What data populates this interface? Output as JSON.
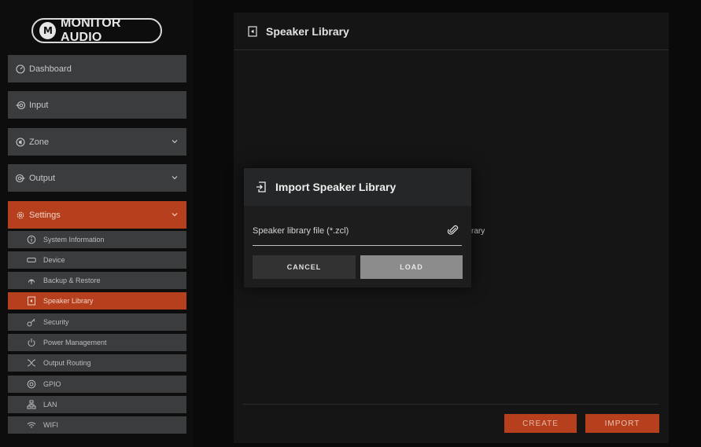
{
  "brand": {
    "logo_mark": "M",
    "logo_text": "MONITOR AUDIO"
  },
  "sidebar": {
    "items": [
      {
        "label": "Dashboard",
        "icon": "dashboard-icon",
        "expandable": false
      },
      {
        "label": "Input",
        "icon": "input-icon",
        "expandable": false
      },
      {
        "label": "Zone",
        "icon": "zone-icon",
        "expandable": true
      },
      {
        "label": "Output",
        "icon": "output-icon",
        "expandable": true
      },
      {
        "label": "Settings",
        "icon": "gear-icon",
        "expandable": true,
        "active": true
      }
    ],
    "settings_items": [
      {
        "label": "System Information",
        "icon": "info-icon"
      },
      {
        "label": "Device",
        "icon": "device-icon"
      },
      {
        "label": "Backup & Restore",
        "icon": "backup-icon"
      },
      {
        "label": "Speaker Library",
        "icon": "speaker-library-icon",
        "active": true
      },
      {
        "label": "Security",
        "icon": "key-icon"
      },
      {
        "label": "Power Management",
        "icon": "power-icon"
      },
      {
        "label": "Output Routing",
        "icon": "routing-icon"
      },
      {
        "label": "GPIO",
        "icon": "gpio-icon"
      },
      {
        "label": "LAN",
        "icon": "lan-icon"
      },
      {
        "label": "WIFI",
        "icon": "wifi-icon"
      }
    ]
  },
  "main": {
    "title": "Speaker Library",
    "background_text": "rary",
    "create_label": "CREATE",
    "import_label": "IMPORT"
  },
  "modal": {
    "title": "Import Speaker Library",
    "file_label": "Speaker library file (*.zcl)",
    "cancel_label": "CANCEL",
    "load_label": "LOAD"
  },
  "colors": {
    "accent": "#b6401e",
    "sidebar_item": "#3a3c3e",
    "panel": "#151515",
    "modal": "#1d1d1d",
    "disabled_button": "#8c8c8c"
  }
}
